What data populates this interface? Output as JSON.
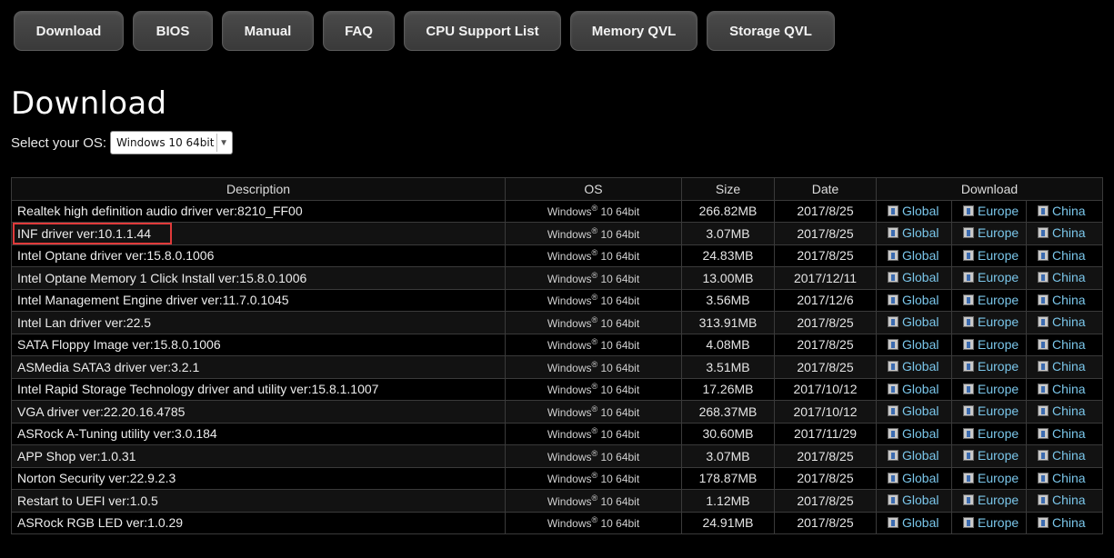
{
  "tabs": [
    "Download",
    "BIOS",
    "Manual",
    "FAQ",
    "CPU Support List",
    "Memory QVL",
    "Storage QVL"
  ],
  "heading": "Download",
  "os_select": {
    "label": "Select your OS:",
    "value": "Windows 10 64bit"
  },
  "table": {
    "headers": {
      "description": "Description",
      "os": "OS",
      "size": "Size",
      "date": "Date",
      "download": "Download"
    },
    "os_text": {
      "prefix": "Windows",
      "reg": "®",
      "suffix": " 10 64bit"
    },
    "links": [
      "Global",
      "Europe",
      "China"
    ],
    "rows": [
      {
        "description": "Realtek high definition audio driver ver:8210_FF00",
        "size": "266.82MB",
        "date": "2017/8/25"
      },
      {
        "description": "INF driver ver:10.1.1.44",
        "size": "3.07MB",
        "date": "2017/8/25"
      },
      {
        "description": "Intel Optane driver ver:15.8.0.1006",
        "size": "24.83MB",
        "date": "2017/8/25"
      },
      {
        "description": "Intel Optane Memory 1 Click Install ver:15.8.0.1006",
        "size": "13.00MB",
        "date": "2017/12/11"
      },
      {
        "description": "Intel Management Engine driver ver:11.7.0.1045",
        "size": "3.56MB",
        "date": "2017/12/6"
      },
      {
        "description": "Intel Lan driver ver:22.5",
        "size": "313.91MB",
        "date": "2017/8/25"
      },
      {
        "description": "SATA Floppy Image ver:15.8.0.1006",
        "size": "4.08MB",
        "date": "2017/8/25"
      },
      {
        "description": "ASMedia SATA3 driver ver:3.2.1",
        "size": "3.51MB",
        "date": "2017/8/25"
      },
      {
        "description": "Intel Rapid Storage Technology driver and utility ver:15.8.1.1007",
        "size": "17.26MB",
        "date": "2017/10/12"
      },
      {
        "description": "VGA driver ver:22.20.16.4785",
        "size": "268.37MB",
        "date": "2017/10/12"
      },
      {
        "description": "ASRock A-Tuning utility ver:3.0.184",
        "size": "30.60MB",
        "date": "2017/11/29"
      },
      {
        "description": "APP Shop ver:1.0.31",
        "size": "3.07MB",
        "date": "2017/8/25"
      },
      {
        "description": "Norton Security ver:22.9.2.3",
        "size": "178.87MB",
        "date": "2017/8/25"
      },
      {
        "description": "Restart to UEFI ver:1.0.5",
        "size": "1.12MB",
        "date": "2017/8/25"
      },
      {
        "description": "ASRock RGB LED ver:1.0.29",
        "size": "24.91MB",
        "date": "2017/8/25"
      }
    ]
  },
  "colors": {
    "link": "#7ac6ea",
    "highlight": "#e03a3a",
    "background": "#000000"
  }
}
